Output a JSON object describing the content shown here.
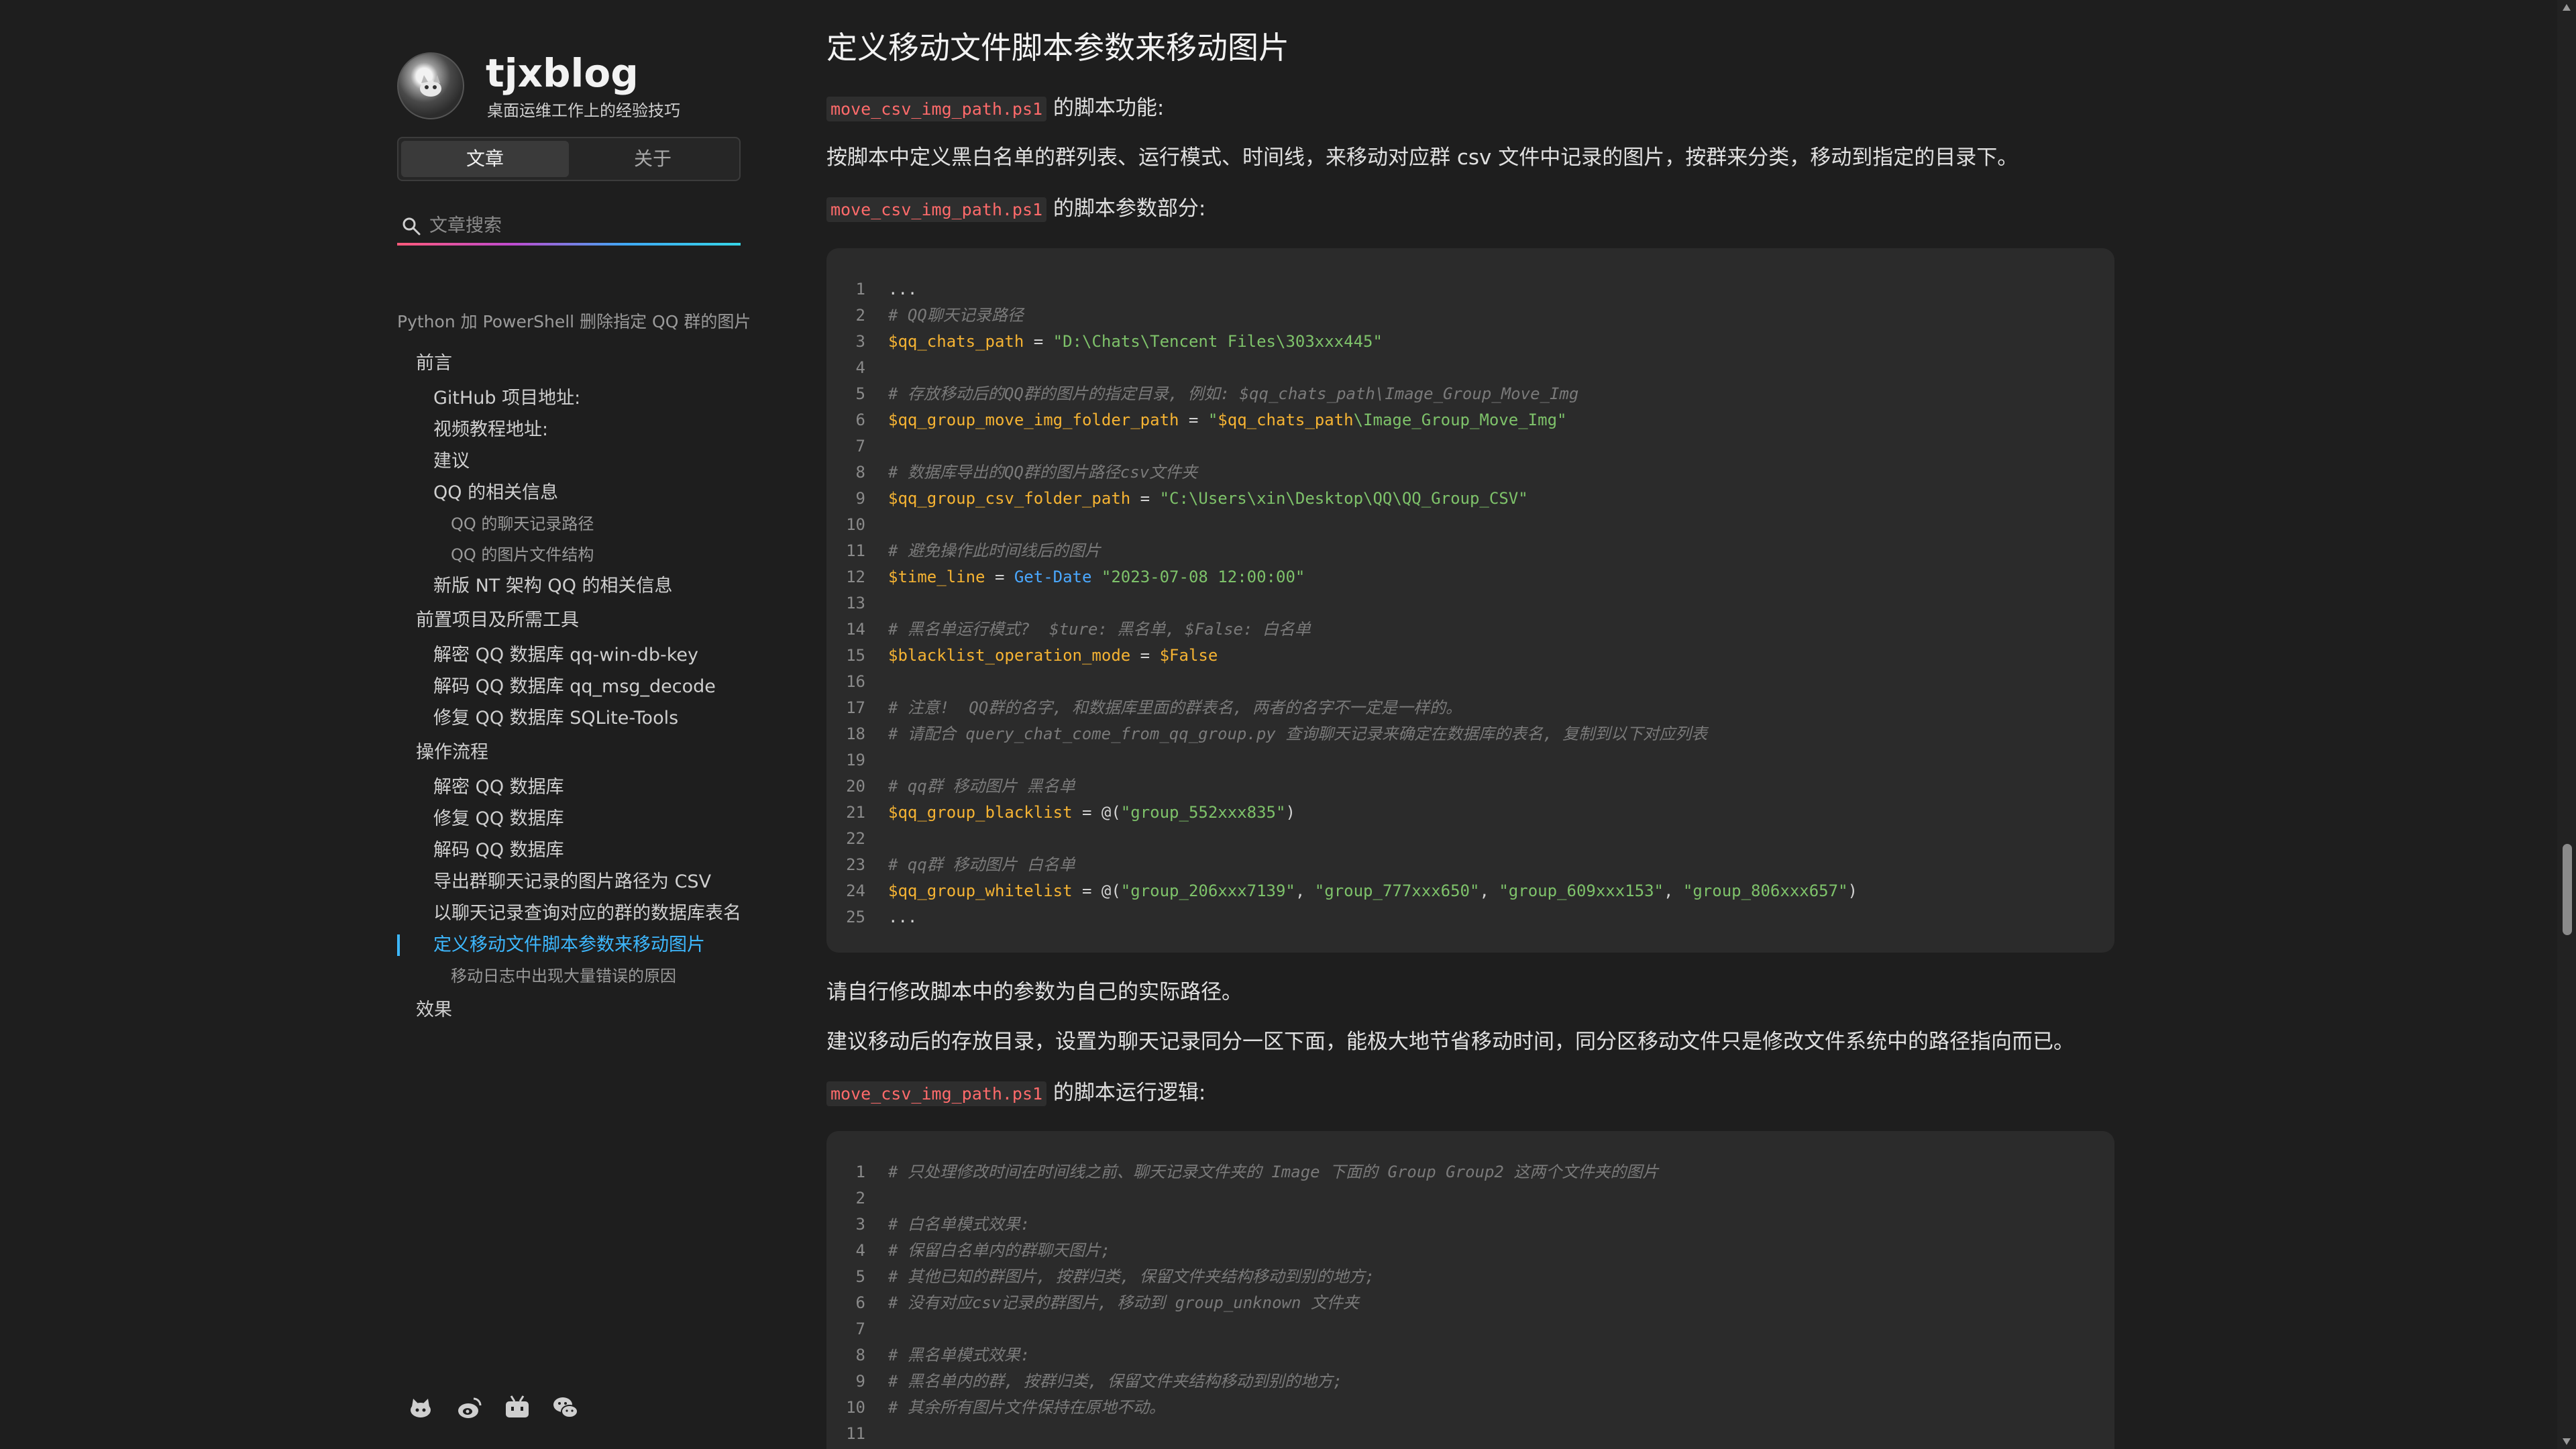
{
  "site": {
    "title": "tjxblog",
    "subtitle": "桌面运维工作上的经验技巧"
  },
  "tabs": {
    "articles": "文章",
    "about": "关于"
  },
  "search": {
    "placeholder": "文章搜索"
  },
  "toc": {
    "top": "Python 加 PowerShell 删除指定 QQ 群的图片",
    "items": [
      {
        "level": 1,
        "label": "前言",
        "active": false
      },
      {
        "level": 2,
        "label": "GitHub 项目地址:",
        "active": false
      },
      {
        "level": 2,
        "label": "视频教程地址:",
        "active": false
      },
      {
        "level": 2,
        "label": "建议",
        "active": false
      },
      {
        "level": 2,
        "label": "QQ 的相关信息",
        "active": false
      },
      {
        "level": 3,
        "label": "QQ 的聊天记录路径",
        "active": false
      },
      {
        "level": 3,
        "label": "QQ 的图片文件结构",
        "active": false
      },
      {
        "level": 2,
        "label": "新版 NT 架构 QQ 的相关信息",
        "active": false
      },
      {
        "level": 1,
        "label": "前置项目及所需工具",
        "active": false
      },
      {
        "level": 2,
        "label": "解密 QQ 数据库 qq-win-db-key",
        "active": false
      },
      {
        "level": 2,
        "label": "解码 QQ 数据库 qq_msg_decode",
        "active": false
      },
      {
        "level": 2,
        "label": "修复 QQ 数据库 SQLite-Tools",
        "active": false
      },
      {
        "level": 1,
        "label": "操作流程",
        "active": false
      },
      {
        "level": 2,
        "label": "解密 QQ 数据库",
        "active": false
      },
      {
        "level": 2,
        "label": "修复 QQ 数据库",
        "active": false
      },
      {
        "level": 2,
        "label": "解码 QQ 数据库",
        "active": false
      },
      {
        "level": 2,
        "label": "导出群聊天记录的图片路径为 CSV",
        "active": false
      },
      {
        "level": 2,
        "label": "以聊天记录查询对应的群的数据库表名",
        "active": false
      },
      {
        "level": 2,
        "label": "定义移动文件脚本参数来移动图片",
        "active": true
      },
      {
        "level": 3,
        "label": "移动日志中出现大量错误的原因",
        "active": false
      },
      {
        "level": 1,
        "label": "效果",
        "active": false
      }
    ]
  },
  "social": [
    "github-icon",
    "weibo-icon",
    "bilibili-icon",
    "wechat-icon"
  ],
  "main": {
    "heading": "定义移动文件脚本参数来移动图片",
    "file": "move_csv_img_path.ps1",
    "p1_suffix": " 的脚本功能:",
    "p2": "按脚本中定义黑白名单的群列表、运行模式、时间线，来移动对应群 csv 文件中记录的图片，按群来分类，移动到指定的目录下。",
    "p3_suffix": " 的脚本参数部分:",
    "p4": "请自行修改脚本中的参数为自己的实际路径。",
    "p5": "建议移动后的存放目录，设置为聊天记录同分一区下面，能极大地节省移动时间，同分区移动文件只是修改文件系统中的路径指向而已。",
    "p6_suffix": " 的脚本运行逻辑:"
  },
  "code1": [
    "...",
    "# QQ聊天记录路径",
    "$qq_chats_path = \"D:\\Chats\\Tencent Files\\303xxx445\"",
    "",
    "# 存放移动后的QQ群的图片的指定目录, 例如: $qq_chats_path\\Image_Group_Move_Img",
    "$qq_group_move_img_folder_path = \"$qq_chats_path\\Image_Group_Move_Img\"",
    "",
    "# 数据库导出的QQ群的图片路径csv文件夹",
    "$qq_group_csv_folder_path = \"C:\\Users\\xin\\Desktop\\QQ\\QQ_Group_CSV\"",
    "",
    "# 避免操作此时间线后的图片",
    "$time_line = Get-Date \"2023-07-08 12:00:00\"",
    "",
    "# 黑名单运行模式?  $ture: 黑名单, $False: 白名单",
    "$blacklist_operation_mode = $False",
    "",
    "# 注意!  QQ群的名字, 和数据库里面的群表名, 两者的名字不一定是一样的。",
    "# 请配合 query_chat_come_from_qq_group.py 查询聊天记录来确定在数据库的表名, 复制到以下对应列表",
    "",
    "# qq群 移动图片 黑名单",
    "$qq_group_blacklist = @(\"group_552xxx835\")",
    "",
    "# qq群 移动图片 白名单",
    "$qq_group_whitelist = @(\"group_206xxx7139\", \"group_777xxx650\", \"group_609xxx153\", \"group_806xxx657\")",
    "..."
  ],
  "code2": [
    "# 只处理修改时间在时间线之前、聊天记录文件夹的 Image 下面的 Group Group2 这两个文件夹的图片",
    "",
    "# 白名单模式效果:",
    "# 保留白名单内的群聊天图片;",
    "# 其他已知的群图片, 按群归类, 保留文件夹结构移动到别的地方;",
    "# 没有对应csv记录的群图片, 移动到 group_unknown 文件夹",
    "",
    "# 黑名单模式效果:",
    "# 黑名单内的群, 按群归类, 保留文件夹结构移动到别的地方;",
    "# 其余所有图片文件保持在原地不动。",
    ""
  ]
}
